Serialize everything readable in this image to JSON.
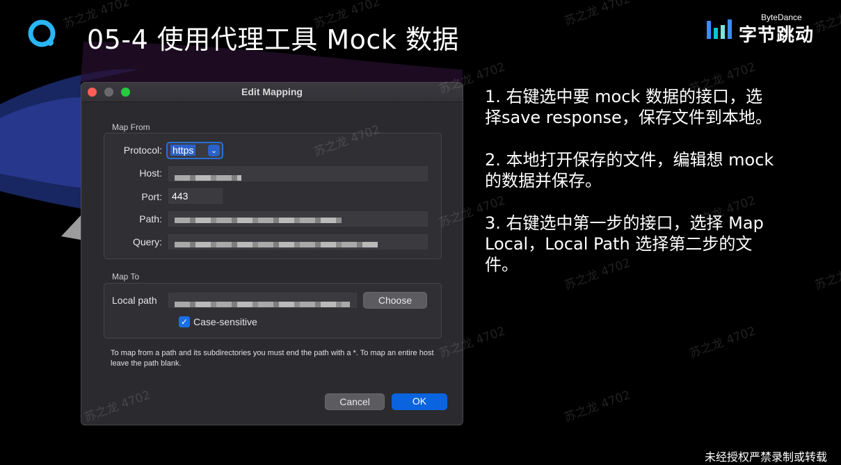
{
  "slide": {
    "title": "05-4 使用代理工具 Mock 数据",
    "brand_en": "ByteDance",
    "brand_cn": "字节跳动",
    "footer": "未经授权严禁录制或转载",
    "watermark": "苏之龙 4702"
  },
  "dialog": {
    "title": "Edit Mapping",
    "map_from_label": "Map From",
    "protocol_label": "Protocol:",
    "protocol_value": "https",
    "host_label": "Host:",
    "port_label": "Port:",
    "port_value": "443",
    "path_label": "Path:",
    "query_label": "Query:",
    "map_to_label": "Map To",
    "local_path_label": "Local path",
    "choose_button": "Choose",
    "case_sensitive_label": "Case-sensitive",
    "case_sensitive_checked": true,
    "help_text": "To map from a path and its subdirectories you must end the path with a *. To map an entire host leave the path blank.",
    "cancel_button": "Cancel",
    "ok_button": "OK"
  },
  "notes": [
    "1. 右键选中要 mock 数据的接口，选择save response，保存文件到本地。",
    "2. 本地打开保存的文件，编辑想 mock 的数据并保存。",
    "3. 右键选中第一步的接口，选择 Map Local，Local Path 选择第二步的文件。"
  ],
  "colors": {
    "accent_blue": "#0a64e0",
    "logo_cyan": "#29b6f6",
    "traffic_close": "#ff5f57",
    "traffic_max": "#28c840"
  }
}
